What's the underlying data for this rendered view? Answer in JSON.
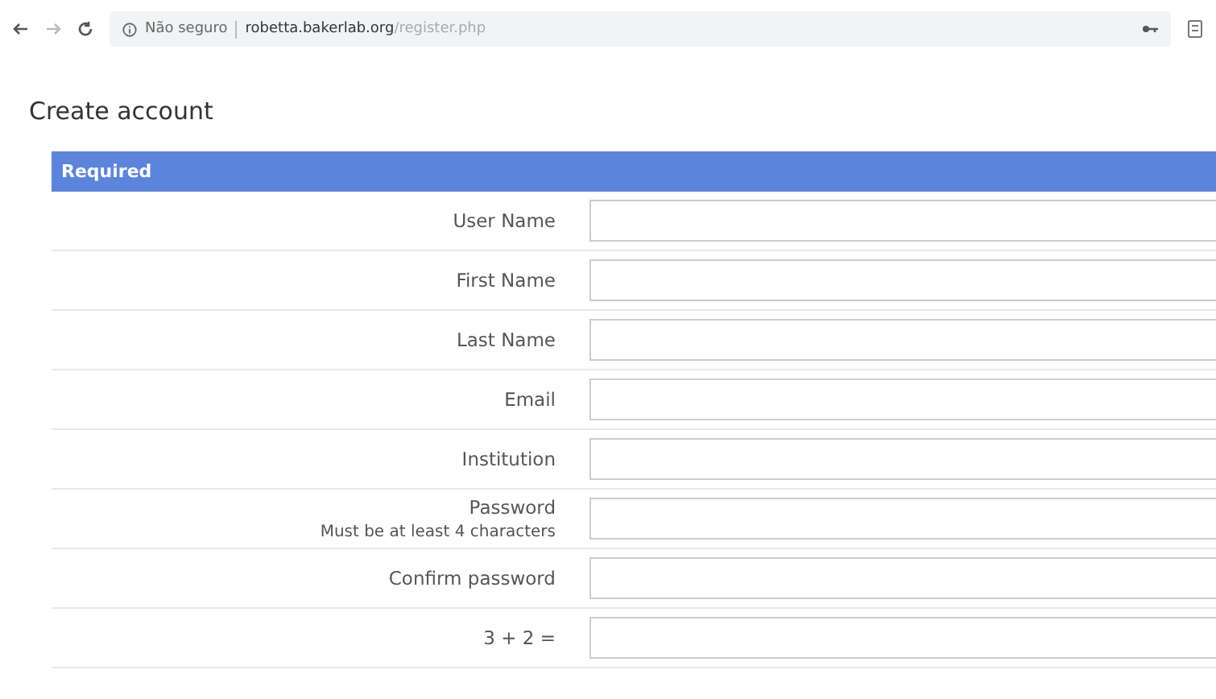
{
  "browser": {
    "security": "Não seguro",
    "host": "robetta.bakerlab.org",
    "path": "/register.php"
  },
  "page": {
    "title": "Create account"
  },
  "form": {
    "section": "Required",
    "fields": [
      {
        "label": "User Name"
      },
      {
        "label": "First Name"
      },
      {
        "label": "Last Name"
      },
      {
        "label": "Email"
      },
      {
        "label": "Institution"
      },
      {
        "label": "Password",
        "hint": "Must be at least 4 characters"
      },
      {
        "label": "Confirm password"
      },
      {
        "label": "3 + 2 ="
      }
    ]
  }
}
